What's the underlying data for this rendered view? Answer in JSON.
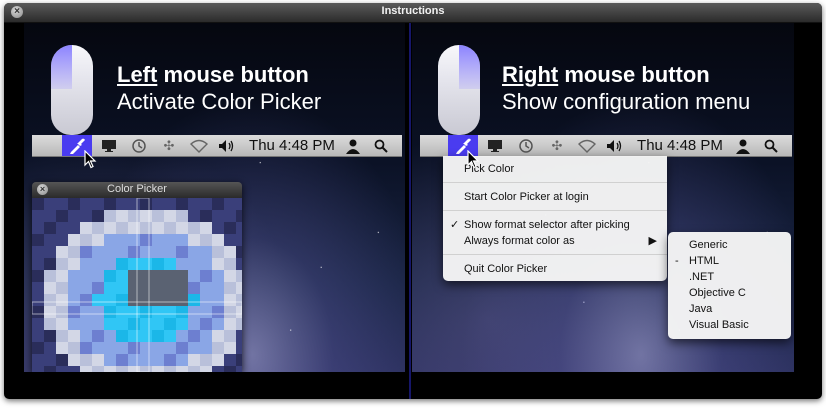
{
  "window": {
    "title": "Instructions"
  },
  "left": {
    "heading_emph": "Left",
    "heading_rest": " mouse button",
    "subheading": "Activate Color Picker"
  },
  "right": {
    "heading_emph": "Right",
    "heading_rest": " mouse button",
    "subheading": "Show configuration menu"
  },
  "menubar": {
    "clock": "Thu 4:48 PM",
    "icons": [
      "eyedropper-icon",
      "display-icon",
      "time-machine-icon",
      "bluetooth-icon",
      "wifi-icon",
      "volume-icon",
      "user-icon",
      "spotlight-icon"
    ]
  },
  "color_picker": {
    "title": "Color Picker"
  },
  "config_menu": {
    "items": [
      {
        "label": "Pick Color",
        "checked": false,
        "submenu": false
      },
      {
        "label": "Start Color Picker at login",
        "checked": false,
        "submenu": false
      },
      {
        "label": "Show format selector after picking",
        "checked": true,
        "submenu": false
      },
      {
        "label": "Always format color as",
        "checked": false,
        "submenu": true
      },
      {
        "label": "Quit Color Picker",
        "checked": false,
        "submenu": false
      }
    ],
    "check_glyph": "✓",
    "arrow_glyph": "▶"
  },
  "format_submenu": {
    "items": [
      "Generic",
      "HTML",
      ".NET",
      "Objective C",
      "Java",
      "Visual Basic"
    ],
    "selected": "HTML",
    "mark_glyph": "-"
  },
  "colors": {
    "accent": "#4a3cf0",
    "divider": "#16166a",
    "menubar_top": "#dcdcdc",
    "menubar_bottom": "#b8b8b8"
  }
}
